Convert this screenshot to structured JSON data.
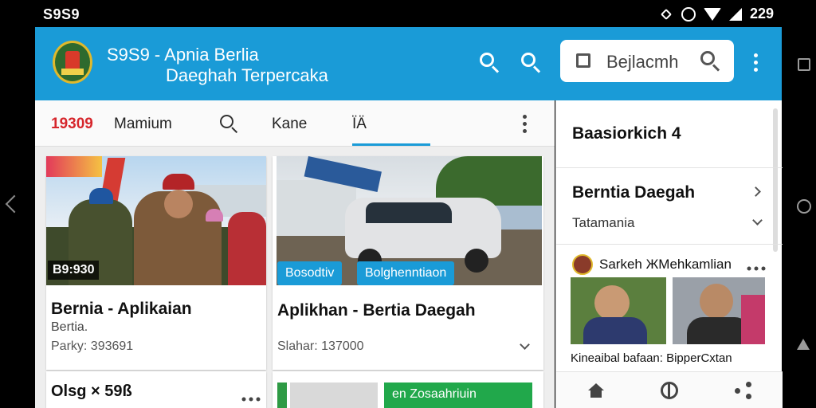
{
  "status": {
    "left_text": "S9S9",
    "right_text": "229"
  },
  "appbar": {
    "title_line1": "S9S9 - Apnia Berlia",
    "title_line2": "Daeghah Terpercaka",
    "search_placeholder": "Bejlacmh"
  },
  "tabs": [
    {
      "label": "19309"
    },
    {
      "label": "Mamium"
    },
    {
      "label": "Kane"
    },
    {
      "label": "ÏÄ"
    }
  ],
  "cards": [
    {
      "badge": "B9:930",
      "title": "Bernia - Aplikaian",
      "subtitle": "Bertia.",
      "meta": "Parky: 393691"
    },
    {
      "chips": [
        "Bosodtiv",
        "Bolghenntiaon"
      ],
      "title": "Aplikhan - Bertia Daegah",
      "meta": "Slahar: 137000"
    }
  ],
  "bottom_cards": [
    {
      "title": "Olsg × 59ß"
    },
    {
      "chip": "en Zosaahriuin"
    }
  ],
  "sidebar": {
    "heading": "Baasiorkich 4",
    "section_title": "Berntia Daegah",
    "section_sub": "Tatamania",
    "post_author": "Sarkeh ЖMehkamlian",
    "post_caption": "Kineaibal bafaan: BipperCxtan"
  }
}
